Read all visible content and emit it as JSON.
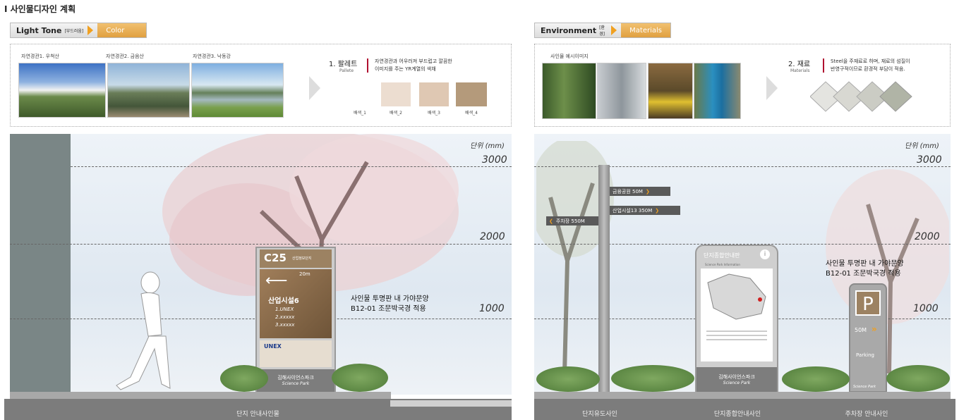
{
  "page": {
    "title": "Ⅰ 사인물디자인 계획"
  },
  "left_tab": {
    "main": "Light Tone",
    "small": "[부드러움]",
    "sub": "Color"
  },
  "right_tab": {
    "main": "Environment",
    "small": "[환경]",
    "sub": "Materials"
  },
  "landscape": {
    "photos": [
      {
        "label": "자연경관1. 우척산"
      },
      {
        "label": "자연경관2. 금음산"
      },
      {
        "label": "자연경관3. 낙동강"
      }
    ]
  },
  "palette": {
    "num": "1. 팔레트",
    "en": "Pallete",
    "desc_line1": "자연경관과 어우러져 부드럽고 깔끔한",
    "desc_line2": "이미지를 주는 YR계열의 색채",
    "swatches": [
      {
        "label": "배색_1",
        "color": "#f8f1ea"
      },
      {
        "label": "배색_2",
        "color": "#ecddd0"
      },
      {
        "label": "배색_3",
        "color": "#dfc8b3"
      },
      {
        "label": "배색_4",
        "color": "#b49a7b"
      }
    ]
  },
  "environment": {
    "photos_label": "사인물 예시이미지"
  },
  "materials": {
    "num": "2. 재료",
    "en": "Materials",
    "desc_line1": "Steel을 주재료로 하며, 재료의 섬질이",
    "desc_line2": "반영구적이므로 환경적 부담이 적음."
  },
  "scale": {
    "unit": "단위 (mm)",
    "h3000": "3000",
    "h2000": "2000",
    "h1000": "1000"
  },
  "left_scene": {
    "sign_code": "C25",
    "sign_code_sub": "산업정보단지",
    "sign_distance": "20m",
    "sign_title": "산업시설6",
    "sign_items": [
      "1.UNEX",
      "2.xxxxx",
      "3.xxxxx"
    ],
    "sign_logo": "UNEX",
    "sign_base": "김해사이언스파크",
    "sign_base_en": "Science Park",
    "note_line1": "사인물 투명판 내 가야문양",
    "note_line2": "B12-01 조문박국경 적용",
    "caption": "단지 안내사인물"
  },
  "right_scene": {
    "pole_signs": [
      {
        "text": "금융공원 50M",
        "arrow": "❯"
      },
      {
        "text": "산업시설13   350M",
        "arrow": "❯"
      },
      {
        "text": "주차장 550M",
        "arrow": "❮"
      }
    ],
    "map_title": "단지종합안내판",
    "map_sub": "Science Park Information",
    "map_base": "김해사이언스파크",
    "map_base_en": "Science Park",
    "note_line1": "사인물 투명판 내 가야문양",
    "note_line2": "B12-01 조문박국경 적용",
    "parking_letter": "P",
    "parking_distance": "50M",
    "parking_label": "Parking",
    "parking_base": "Science Park",
    "captions": [
      "단지유도사인",
      "단지종합안내사인",
      "주차장 안내사인"
    ]
  }
}
